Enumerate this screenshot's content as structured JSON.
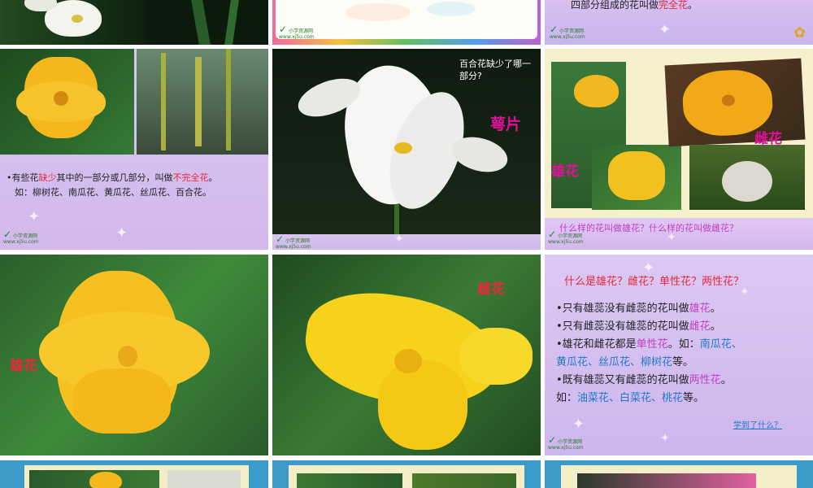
{
  "slides": {
    "s3_text": "四部分组成的花叫做",
    "s3_red": "完全花",
    "s3_end": "。",
    "s4_p1": "•有些花",
    "s4_r1": "缺少",
    "s4_p2": "其中的一部分或几部分，叫做",
    "s4_r2": "不完全花",
    "s4_p3": "。",
    "s4_line2": "如：柳树花、南瓜花、黄瓜花、丝瓜花、百合花。",
    "s5_question": "百合花缺少了哪一部分?",
    "s5_answer": "萼片",
    "s6_female": "雌花",
    "s6_male": "雄花",
    "s6_question": "什么样的花叫做雄花？什么样的花叫做雌花？",
    "s7_label": "雄花",
    "s8_label": "雌花",
    "s9_title": "什么是雄花？雌花？单性花？两性花？",
    "s9_l1a": "•只有雄蕊没有雌蕊的花叫做",
    "s9_l1b": "雄花",
    "s9_l1c": "。",
    "s9_l2a": "•只有雌蕊没有雄蕊的花叫做",
    "s9_l2b": "雌花",
    "s9_l2c": "。",
    "s9_l3a": "•雄花和雌花都是",
    "s9_l3b": "单性花",
    "s9_l3c": "。如：",
    "s9_l3d": "南瓜花、",
    "s9_l4a": "黄瓜花、丝瓜花、柳树花",
    "s9_l4b": "等。",
    "s9_l5a": "•既有雄蕊又有雌蕊的花叫做",
    "s9_l5b": "两性花",
    "s9_l5c": "。",
    "s9_l6a": "如：",
    "s9_l6b": "油菜花、白菜花、桃花",
    "s9_l6c": "等。",
    "s9_link": "学到了什么？"
  },
  "logo": {
    "name": "小学资源网",
    "url": "www.xj5u.com"
  },
  "colors": {
    "highlight_red": "#e8283c",
    "highlight_purple": "#c040c0",
    "highlight_blue": "#1e78c8",
    "label_magenta": "#e0109a"
  }
}
